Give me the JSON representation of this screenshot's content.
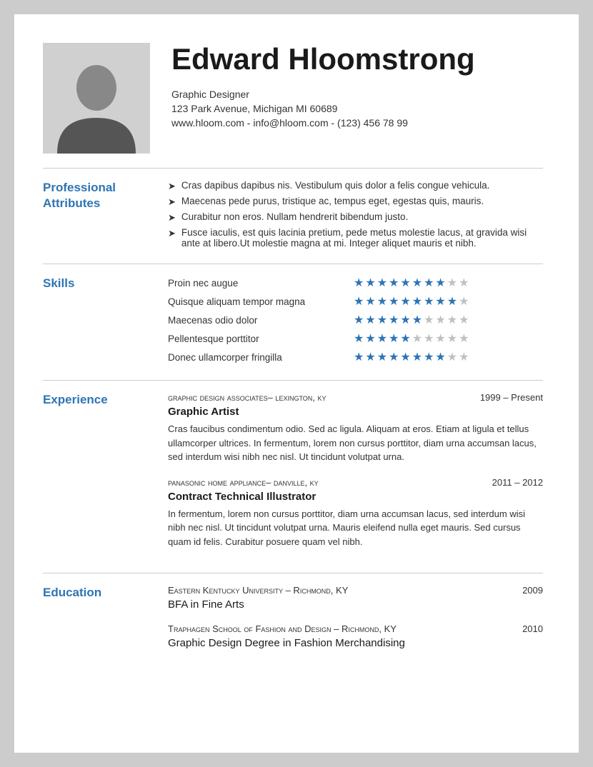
{
  "header": {
    "name": "Edward Hloomstrong",
    "job_title": "Graphic Designer",
    "address": "123 Park Avenue, Michigan MI 60689",
    "contact": "www.hloom.com - info@hloom.com - (123) 456 78 99"
  },
  "sections": {
    "professional": {
      "label": "Professional\nAttributes",
      "items": [
        "Cras dapibus dapibus nis. Vestibulum quis dolor a felis congue vehicula.",
        "Maecenas pede purus, tristique ac, tempus eget, egestas quis, mauris.",
        "Curabitur non eros. Nullam hendrerit bibendum justo.",
        "Fusce iaculis, est quis lacinia pretium, pede metus molestie lacus, at gravida wisi ante at libero.Ut molestie magna at mi. Integer aliquet mauris et nibh."
      ]
    },
    "skills": {
      "label": "Skills",
      "items": [
        {
          "name": "Proin nec augue",
          "filled": 8,
          "total": 10
        },
        {
          "name": "Quisque aliquam tempor magna",
          "filled": 9,
          "total": 10
        },
        {
          "name": "Maecenas odio dolor",
          "filled": 6,
          "total": 10
        },
        {
          "name": "Pellentesque porttitor",
          "filled": 5,
          "total": 10
        },
        {
          "name": "Donec ullamcorper fringilla",
          "filled": 8,
          "total": 10
        }
      ]
    },
    "experience": {
      "label": "Experience",
      "items": [
        {
          "company": "Graphic Design Associates",
          "location": "Lexington, KY",
          "dash": "–",
          "dates": "1999 – Present",
          "title": "Graphic Artist",
          "description": "Cras faucibus condimentum odio. Sed ac ligula. Aliquam at eros. Etiam at ligula et tellus ullamcorper ultrices. In fermentum, lorem non cursus porttitor, diam urna accumsan lacus, sed interdum wisi nibh nec nisl. Ut tincidunt volutpat urna."
        },
        {
          "company": "Panasonic Home Appliance",
          "location": "Danville, KY",
          "dash": "–",
          "dates": "2011 – 2012",
          "title": "Contract Technical Illustrator",
          "description": "In fermentum, lorem non cursus porttitor, diam urna accumsan lacus, sed interdum wisi nibh nec nisl. Ut tincidunt volutpat urna. Mauris eleifend nulla eget mauris. Sed cursus quam id felis. Curabitur posuere quam vel nibh."
        }
      ]
    },
    "education": {
      "label": "Education",
      "items": [
        {
          "school": "Eastern Kentucky University",
          "location": "Richmond, KY",
          "dash": "–",
          "year": "2009",
          "degree": "BFA in Fine Arts"
        },
        {
          "school": "Traphagen School of Fashion and Design",
          "location": "Richmond, KY",
          "dash": "–",
          "year": "2010",
          "degree": "Graphic Design Degree in Fashion Merchandising"
        }
      ]
    }
  },
  "colors": {
    "accent": "#2e74b5",
    "text": "#333333",
    "star_filled": "#2e74b5",
    "star_empty": "#c0c0c0"
  }
}
